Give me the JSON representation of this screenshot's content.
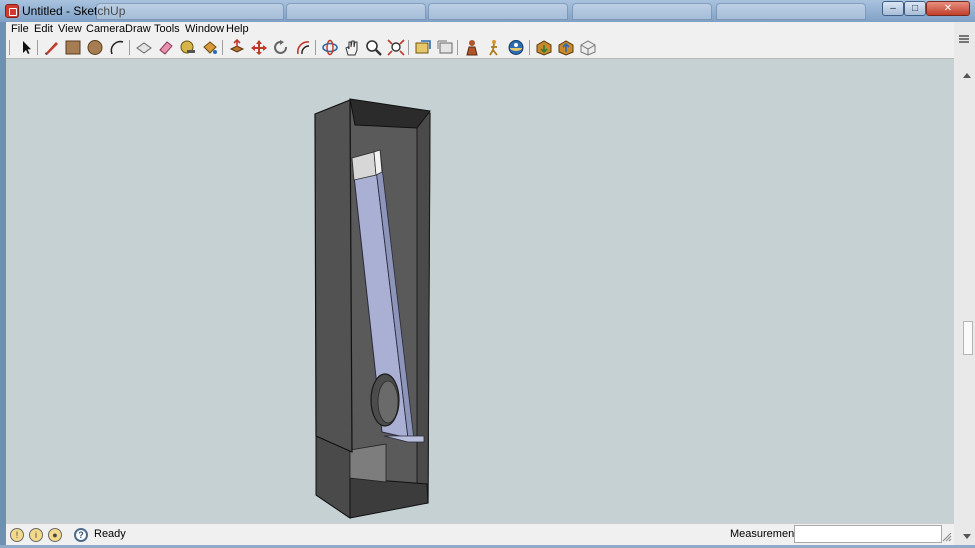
{
  "window": {
    "title": "Untitled - SketchUp",
    "controls": [
      "minimize",
      "maximize",
      "close"
    ]
  },
  "menu": [
    "File",
    "Edit",
    "View",
    "Camera",
    "Draw",
    "Tools",
    "Window",
    "Help"
  ],
  "toolbar": {
    "tools": [
      "select",
      "line",
      "rectangle",
      "circle",
      "arc",
      "make-component",
      "eraser",
      "tape-measure",
      "paint-bucket",
      "push-pull",
      "move",
      "rotate",
      "offset",
      "orbit",
      "pan",
      "zoom",
      "zoom-extents",
      "previous-view",
      "next-view",
      "position-camera",
      "walk",
      "look-around",
      "get-models",
      "share-model",
      "components"
    ]
  },
  "status": {
    "text": "Ready",
    "measurements_label": "Measurements",
    "measurements_value": ""
  },
  "colors": {
    "viewport": "#c6d1d4",
    "chrome": "#f0f0f0",
    "title_gradient_top": "#a9c3df",
    "model_dark": "#4a4a4a",
    "model_panel": "#a9b0d4"
  }
}
